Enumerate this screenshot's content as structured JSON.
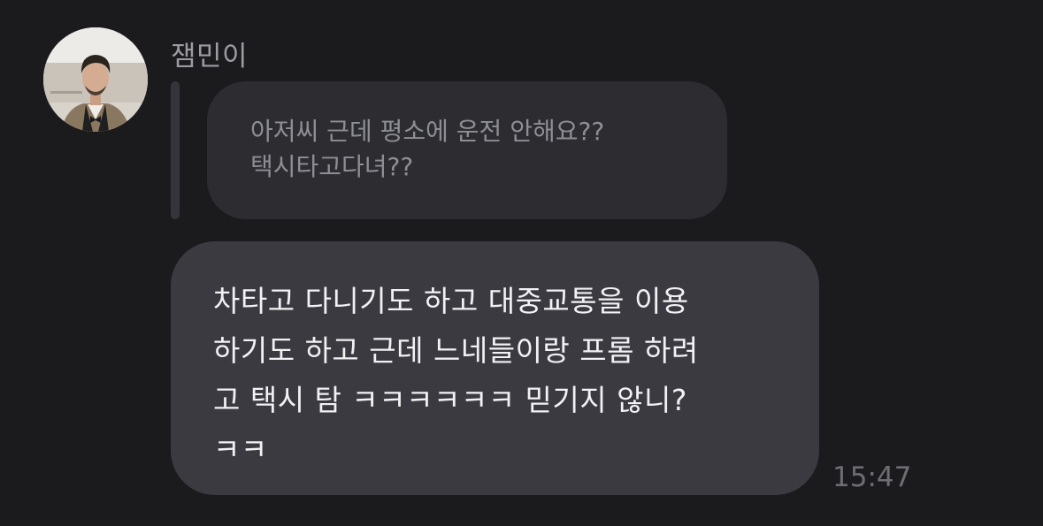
{
  "chat": {
    "sender_name": "잼민이",
    "quoted_message": {
      "line1": "아저씨 근데 평소에 운전 안해요??",
      "line2": "택시타고다녀??"
    },
    "message": {
      "line1": "차타고 다니기도 하고 대중교통을 이용",
      "line2": "하기도 하고 근데 느네들이랑 프롬 하려",
      "line3": "고 택시 탐 ㅋㅋㅋㅋㅋㅋ 믿기지 않니?",
      "line4": "ㅋㅋ"
    },
    "timestamp": "15:47"
  },
  "colors": {
    "background": "#1b1b1e",
    "quoted_bubble": "#2c2c31",
    "message_bubble": "#3a3a40",
    "sender_name": "#9c9ca3",
    "timestamp": "#6d6d73"
  }
}
